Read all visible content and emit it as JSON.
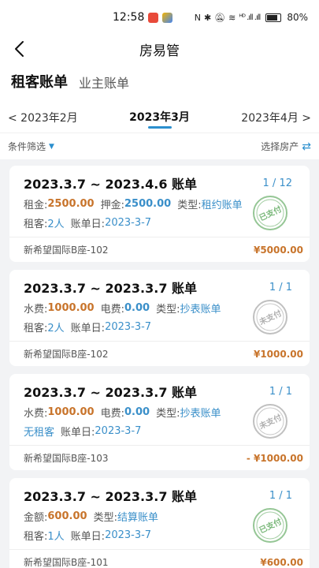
{
  "status_bar": {
    "time": "12:58",
    "signal_text": "ᴴᴰ .ıll .ıll",
    "battery": "80%"
  },
  "nav": {
    "back_icon": "chevron-left-icon",
    "title": "房易管"
  },
  "type_tabs": {
    "tenant": "租客账单",
    "landlord": "业主账单"
  },
  "months": {
    "prev": "< 2023年2月",
    "current": "2023年3月",
    "next": "2023年4月 >"
  },
  "filter": {
    "condition": "条件筛选",
    "select_property": "选择房产"
  },
  "colors": {
    "accent": "#2b8fce",
    "amount": "#c8742b",
    "stamp_paid": "#7ab87a",
    "stamp_unpaid": "#b0b0b0"
  },
  "bills": [
    {
      "title": "2023.3.7 ~ 2023.4.6 账单",
      "page": "1 / 12",
      "row1": {
        "l1": "租金:",
        "v1": "2500.00",
        "l2": "押金:",
        "v2": "2500.00",
        "l3": "类型:",
        "v3": "租约账单"
      },
      "row2": {
        "l1": "租客:",
        "v1": "2人",
        "l2": "账单日:",
        "v2": "2023-3-7"
      },
      "stamp": "已支付",
      "address": "新希望国际B座-102",
      "amount": "¥5000.00"
    },
    {
      "title": "2023.3.7 ~ 2023.3.7 账单",
      "page": "1 / 1",
      "row1": {
        "l1": "水费:",
        "v1": "1000.00",
        "l2": "电费:",
        "v2": "0.00",
        "l3": "类型:",
        "v3": "抄表账单"
      },
      "row2": {
        "l1": "租客:",
        "v1": "2人",
        "l2": "账单日:",
        "v2": "2023-3-7"
      },
      "stamp": "未支付",
      "address": "新希望国际B座-102",
      "amount": "¥1000.00"
    },
    {
      "title": "2023.3.7 ~ 2023.3.7 账单",
      "page": "1 / 1",
      "row1": {
        "l1": "水费:",
        "v1": "1000.00",
        "l2": "电费:",
        "v2": "0.00",
        "l3": "类型:",
        "v3": "抄表账单"
      },
      "row2": {
        "v1": "无租客",
        "l2": "账单日:",
        "v2": "2023-3-7"
      },
      "stamp": "未支付",
      "address": "新希望国际B座-103",
      "amount": "- ¥1000.00"
    },
    {
      "title": "2023.3.7 ~ 2023.3.7 账单",
      "page": "1 / 1",
      "row1": {
        "l1": "金额:",
        "v1": "600.00",
        "l2": "类型:",
        "v2": "结算账单"
      },
      "row2": {
        "l1": "租客:",
        "v1": "1人",
        "l2": "账单日:",
        "v2": "2023-3-7"
      },
      "stamp": "已支付",
      "address": "新希望国际B座-101",
      "amount": "¥600.00"
    }
  ]
}
